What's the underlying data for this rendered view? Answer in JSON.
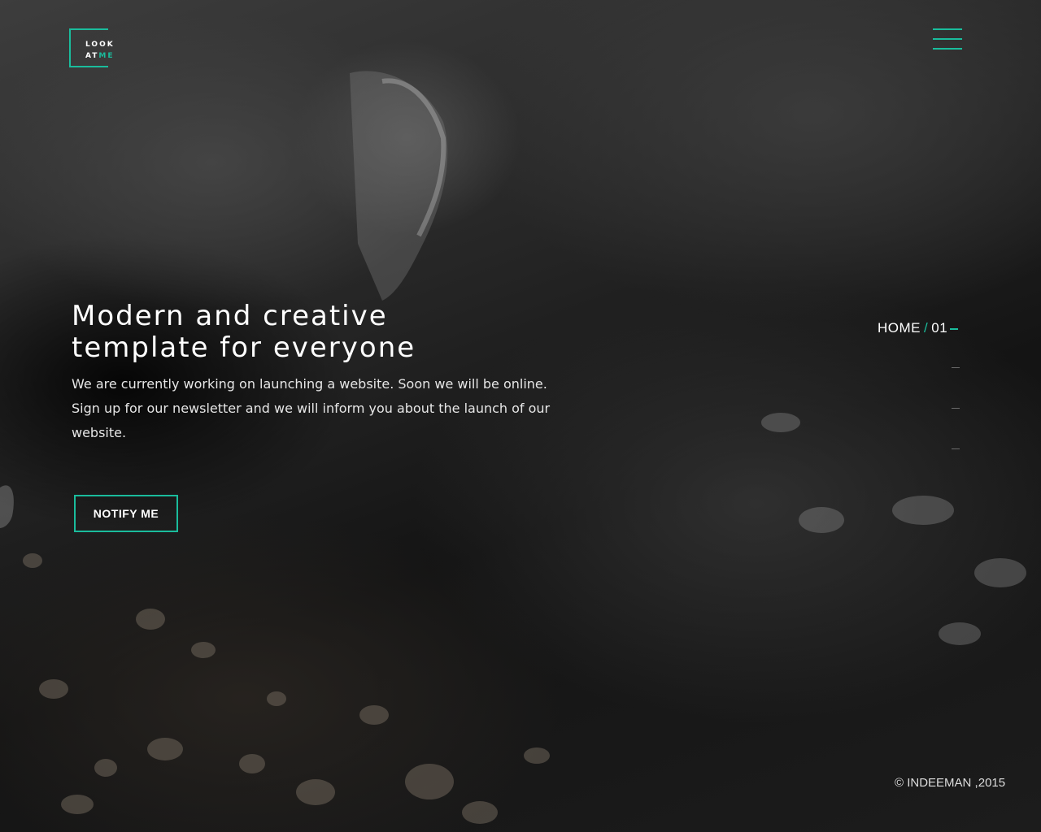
{
  "logo": {
    "line1": "LOOK",
    "line2_plain": "AT",
    "line2_accent": "ME",
    "accent_color": "#1abc9c"
  },
  "header": {
    "menu_icon": "hamburger-menu-icon"
  },
  "hero": {
    "title_line1": "Modern and creative",
    "title_line2": "template for everyone",
    "description_line1": "We are currently working on launching a website. Soon we will be online.",
    "description_line2": "Sign up for our newsletter and we will inform you about the launch of our",
    "description_line3": "website.",
    "notify_label": "NOTIFY ME"
  },
  "page_nav": {
    "section": "HOME",
    "separator": "/",
    "number": "01"
  },
  "footer": {
    "copyright": "© INDEEMAN ,2015"
  },
  "colors": {
    "accent": "#1abc9c",
    "background": "#1a1a1a",
    "text": "#ffffff"
  }
}
